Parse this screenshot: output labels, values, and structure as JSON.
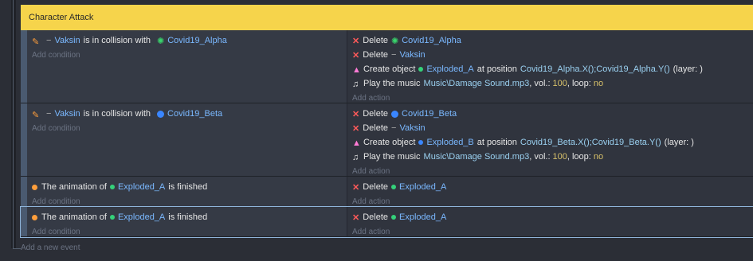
{
  "group": {
    "title": "Character Attack"
  },
  "events": [
    {
      "conditions": [
        {
          "prefix_icon": "brush-icon",
          "obj1": "Vaksin",
          "text": "is in collision with",
          "obj2_icon": "virus-green-icon",
          "obj2": "Covid19_Alpha"
        }
      ],
      "add_condition": "Add condition",
      "actions": [
        {
          "type": "delete",
          "label": "Delete",
          "obj_icon": "virus-green-icon",
          "obj": "Covid19_Alpha"
        },
        {
          "type": "delete",
          "label": "Delete",
          "obj_icon": "dash-icon",
          "obj": "Vaksin"
        },
        {
          "type": "create",
          "label": "Create object",
          "obj": "Exploded_A",
          "at": "at position",
          "pos": "Covid19_Alpha.X();Covid19_Alpha.Y()",
          "layer": "(layer: )"
        },
        {
          "type": "music",
          "label": "Play the music",
          "file": "Music\\Damage Sound.mp3",
          "vol_label": ", vol.:",
          "vol": "100",
          "loop_label": ", loop:",
          "loop": "no"
        }
      ],
      "add_action": "Add action"
    },
    {
      "conditions": [
        {
          "prefix_icon": "brush-icon",
          "obj1": "Vaksin",
          "text": "is in collision with",
          "obj2_icon": "virus-blue-icon",
          "obj2": "Covid19_Beta"
        }
      ],
      "add_condition": "Add condition",
      "actions": [
        {
          "type": "delete",
          "label": "Delete",
          "obj_icon": "virus-blue-icon",
          "obj": "Covid19_Beta"
        },
        {
          "type": "delete",
          "label": "Delete",
          "obj_icon": "dash-icon",
          "obj": "Vaksin"
        },
        {
          "type": "create",
          "label": "Create object",
          "obj": "Exploded_B",
          "at": "at position",
          "pos": "Covid19_Beta.X();Covid19_Beta.Y()",
          "layer": "(layer: )"
        },
        {
          "type": "music",
          "label": "Play the music",
          "file": "Music\\Damage Sound.mp3",
          "vol_label": ", vol.:",
          "vol": "100",
          "loop_label": ", loop:",
          "loop": "no"
        }
      ],
      "add_action": "Add action"
    },
    {
      "conditions": [
        {
          "prefix_icon": "animation-icon",
          "text1": "The animation of",
          "obj": "Exploded_A",
          "text2": "is finished"
        }
      ],
      "add_condition": "Add condition",
      "actions": [
        {
          "type": "delete",
          "label": "Delete",
          "obj": "Exploded_A"
        }
      ],
      "add_action": "Add action"
    },
    {
      "conditions": [
        {
          "prefix_icon": "animation-icon",
          "text1": "The animation of",
          "obj": "Exploded_A",
          "text2": "is finished"
        }
      ],
      "add_condition": "Add condition",
      "actions": [
        {
          "type": "delete",
          "label": "Delete",
          "obj": "Exploded_A"
        }
      ],
      "add_action": "Add action"
    }
  ],
  "footer": {
    "add_event": "Add a new event"
  },
  "colors": {
    "header": "#f6d44b",
    "object": "#7ab8ff",
    "delete": "#ff5a5a",
    "green": "#34d17a",
    "blue": "#3a86ff"
  }
}
